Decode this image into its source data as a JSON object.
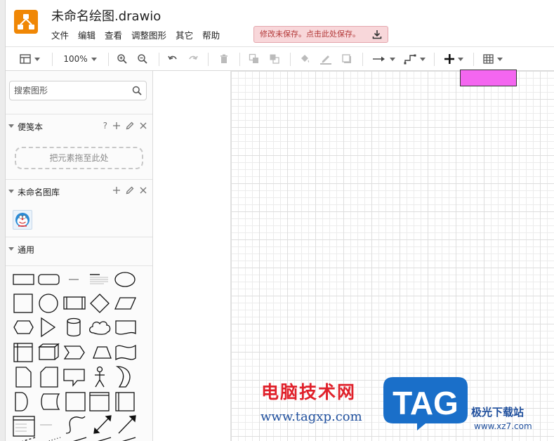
{
  "window": {
    "title": "未命名绘图.drawio"
  },
  "menu": [
    "文件",
    "编辑",
    "查看",
    "调整图形",
    "其它",
    "帮助"
  ],
  "notice": {
    "unsaved": "修改未保存。点击此处保存。"
  },
  "toolbar": {
    "zoom": "100%"
  },
  "sidebar": {
    "search_placeholder": "搜索图形",
    "scratchpad": {
      "title": "便笺本",
      "help": "?",
      "dropzone": "把元素拖至此处"
    },
    "library": {
      "title": "未命名图库"
    },
    "general": {
      "title": "通用"
    }
  },
  "colors": {
    "shape_fill": "#f466f0",
    "logo": "#f08705",
    "unsaved_bg": "#f8d7da"
  },
  "watermark": {
    "brand_cn": "电脑技术网",
    "brand_url": "www.tagxp.com",
    "tag": "TAG",
    "site_cn": "极光下载站",
    "site_url": "www.xz7.com"
  }
}
